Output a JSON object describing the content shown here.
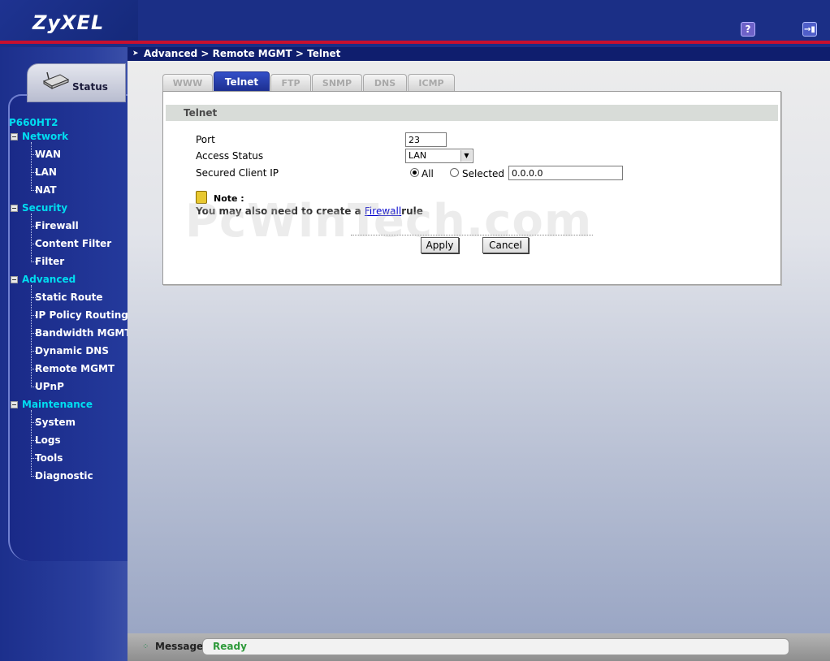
{
  "header": {
    "logo": "ZyXEL",
    "help_label": "?",
    "logout_label": "→▮"
  },
  "breadcrumb": "Advanced > Remote MGMT > Telnet",
  "sidebar": {
    "status_label": "Status",
    "model": "P660HT2",
    "groups": [
      {
        "label": "Network",
        "items": [
          "WAN",
          "LAN",
          "NAT"
        ]
      },
      {
        "label": "Security",
        "items": [
          "Firewall",
          "Content Filter",
          "Filter"
        ]
      },
      {
        "label": "Advanced",
        "items": [
          "Static Route",
          "IP Policy Routing",
          "Bandwidth MGMT",
          "Dynamic DNS",
          "Remote MGMT",
          "UPnP"
        ]
      },
      {
        "label": "Maintenance",
        "items": [
          "System",
          "Logs",
          "Tools",
          "Diagnostic"
        ]
      }
    ]
  },
  "tabs": [
    {
      "label": "WWW",
      "active": false
    },
    {
      "label": "Telnet",
      "active": true
    },
    {
      "label": "FTP",
      "active": false
    },
    {
      "label": "SNMP",
      "active": false
    },
    {
      "label": "DNS",
      "active": false
    },
    {
      "label": "ICMP",
      "active": false
    }
  ],
  "panel": {
    "title": "Telnet",
    "port_label": "Port",
    "port_value": "23",
    "access_label": "Access Status",
    "access_value": "LAN",
    "secured_label": "Secured Client IP",
    "radio_all": "All",
    "radio_selected": "Selected",
    "radio_checked": "All",
    "ip_value": "0.0.0.0",
    "note_label": "Note :",
    "note_prefix": "You may also need to create a ",
    "note_link": "Firewall",
    "note_suffix": "rule",
    "apply_label": "Apply",
    "cancel_label": "Cancel"
  },
  "watermark": "PcWinTech.com",
  "statusbar": {
    "label": "Message",
    "text": "Ready"
  },
  "colors": {
    "header_blue": "#1b2f86",
    "header_red": "#c8102e",
    "group_cyan": "#00ddf0",
    "ready_green": "#2e9a3a"
  }
}
